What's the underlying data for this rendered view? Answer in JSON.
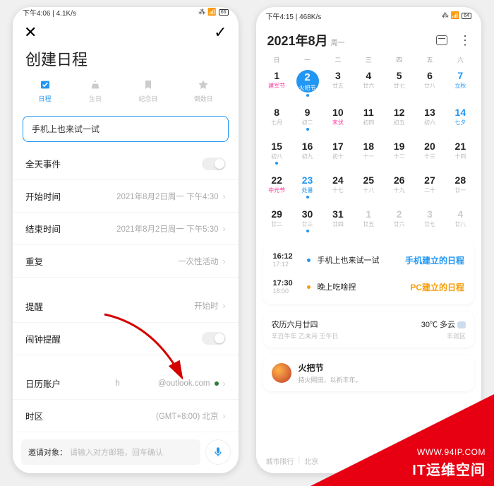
{
  "watermark": {
    "url": "WWW.94IP.COM",
    "cn": "IT运维空间"
  },
  "left": {
    "status": {
      "time": "下午4:06",
      "net": "4.1K/s",
      "batt": "66"
    },
    "header": {
      "title": "创建日程"
    },
    "tabs": [
      {
        "label": "日程",
        "active": true
      },
      {
        "label": "生日",
        "active": false
      },
      {
        "label": "纪念日",
        "active": false
      },
      {
        "label": "倒数日",
        "active": false
      }
    ],
    "subject": "手机上也来试一试",
    "rows": {
      "allday_label": "全天事件",
      "start_label": "开始时间",
      "start_value": "2021年8月2日周一 下午4:30",
      "end_label": "结束时间",
      "end_value": "2021年8月2日周一 下午5:30",
      "repeat_label": "重复",
      "repeat_value": "一次性活动",
      "remind_label": "提醒",
      "remind_value": "开始时",
      "alarm_label": "闹钟提醒",
      "account_label": "日历账户",
      "account_prefix": "h",
      "account_domain": "@outlook.com",
      "tz_label": "时区",
      "tz_value": "(GMT+8:00) 北京"
    },
    "invite": {
      "label": "邀请对象：",
      "placeholder": "请输入对方邮箱，回车确认"
    }
  },
  "right": {
    "status": {
      "time": "下午4:15",
      "net": "468K/s",
      "batt": "64"
    },
    "header": {
      "month": "2021年8月",
      "weekday": "周一"
    },
    "weekdays": [
      "日",
      "一",
      "二",
      "三",
      "四",
      "五",
      "六"
    ],
    "grid": [
      {
        "d": "1",
        "sub": "建军节",
        "cls": "fest"
      },
      {
        "d": "2",
        "sub": "火把节",
        "cls": "selected fest evt"
      },
      {
        "d": "3",
        "sub": "廿五"
      },
      {
        "d": "4",
        "sub": "廿六"
      },
      {
        "d": "5",
        "sub": "廿七"
      },
      {
        "d": "6",
        "sub": "廿八"
      },
      {
        "d": "7",
        "sub": "立秋",
        "cls": "term"
      },
      {
        "d": "8",
        "sub": "七月"
      },
      {
        "d": "9",
        "sub": "初二",
        "cls": "evt"
      },
      {
        "d": "10",
        "sub": "末伏",
        "cls": "fest"
      },
      {
        "d": "11",
        "sub": "初四"
      },
      {
        "d": "12",
        "sub": "初五"
      },
      {
        "d": "13",
        "sub": "初六"
      },
      {
        "d": "14",
        "sub": "七夕",
        "cls": "term"
      },
      {
        "d": "15",
        "sub": "初八",
        "cls": "evt"
      },
      {
        "d": "16",
        "sub": "初九"
      },
      {
        "d": "17",
        "sub": "初十"
      },
      {
        "d": "18",
        "sub": "十一"
      },
      {
        "d": "19",
        "sub": "十二"
      },
      {
        "d": "20",
        "sub": "十三"
      },
      {
        "d": "21",
        "sub": "十四"
      },
      {
        "d": "22",
        "sub": "中元节",
        "cls": "fest"
      },
      {
        "d": "23",
        "sub": "处暑",
        "cls": "term evt"
      },
      {
        "d": "24",
        "sub": "十七"
      },
      {
        "d": "25",
        "sub": "十八"
      },
      {
        "d": "26",
        "sub": "十九"
      },
      {
        "d": "27",
        "sub": "二十"
      },
      {
        "d": "28",
        "sub": "廿一"
      },
      {
        "d": "29",
        "sub": "廿二"
      },
      {
        "d": "30",
        "sub": "廿三",
        "cls": "evt"
      },
      {
        "d": "31",
        "sub": "廿四"
      },
      {
        "d": "1",
        "sub": "廿五",
        "cls": "dim"
      },
      {
        "d": "2",
        "sub": "廿六",
        "cls": "dim"
      },
      {
        "d": "3",
        "sub": "廿七",
        "cls": "dim"
      },
      {
        "d": "4",
        "sub": "廿八",
        "cls": "dim"
      }
    ],
    "events": [
      {
        "t1": "16:12",
        "t2": "17:12",
        "title": "手机上也来试一试",
        "note": "手机建立的日程",
        "noteClass": "note-blue",
        "dot": "#2196f3"
      },
      {
        "t1": "17:30",
        "t2": "18:00",
        "title": "晚上吃啥捏",
        "note": "PC建立的日程",
        "noteClass": "note-orange",
        "dot": "#f59e0b"
      }
    ],
    "weather": {
      "lunar": "农历六月廿四",
      "ganzhi": "辛丑牛年 乙未月 壬午日",
      "temp": "30℃ 多云",
      "loc": "丰润区"
    },
    "festival": {
      "title": "火把节",
      "sub": "持火照田，以祈丰年。"
    },
    "footer": {
      "a": "城市限行",
      "b": "北京"
    }
  }
}
